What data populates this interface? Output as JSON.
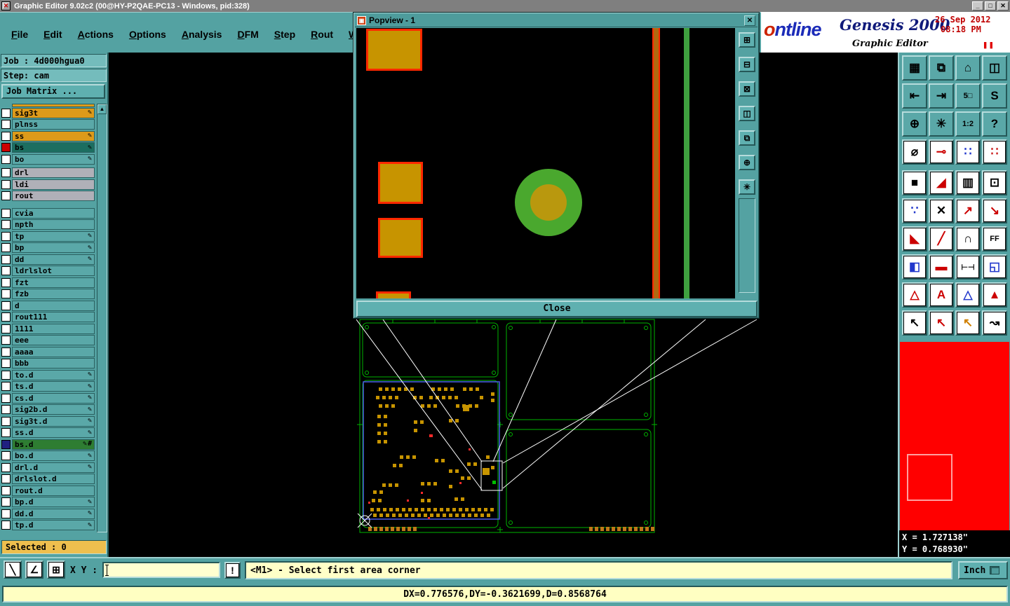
{
  "titlebar": {
    "title": "Graphic Editor 9.02c2 (00@HY-P2QAE-PC13 - Windows, pid:328)",
    "minimize": "_",
    "maximize": "□",
    "close": "✕"
  },
  "menu": {
    "items": [
      "File",
      "Edit",
      "Actions",
      "Options",
      "Analysis",
      "DFM",
      "Step",
      "Rout",
      "Windows"
    ]
  },
  "brand": {
    "logo": "ontline",
    "product": "Genesis 2000",
    "app": "Graphic Editor",
    "date": "26 Sep 2012",
    "time": "08:18 PM",
    "pause": "❚❚"
  },
  "job": {
    "job": "Job : 4d000hgua0",
    "step": "Step: cam",
    "matrix": "Job Matrix ..."
  },
  "layers": {
    "rows": [
      {
        "name": "sig3t",
        "style": "lorange",
        "pencil": true
      },
      {
        "name": "plnss",
        "style": "lteal",
        "pencil": false
      },
      {
        "name": "ss",
        "style": "lorange",
        "pencil": true
      },
      {
        "name": "bs",
        "style": "ldark",
        "pencil": true,
        "indicator": "#cc0000"
      },
      {
        "name": "bo",
        "style": "lteal",
        "pencil": true
      },
      {
        "name": "drl",
        "style": "lgray",
        "pencil": false,
        "gap": 3
      },
      {
        "name": "ldi",
        "style": "lgray",
        "pencil": false
      },
      {
        "name": "rout",
        "style": "lgray",
        "pencil": false
      },
      {
        "name": "cvia",
        "style": "lteal",
        "pencil": false,
        "gap": 8
      },
      {
        "name": "npth",
        "style": "lteal",
        "pencil": false
      },
      {
        "name": "tp",
        "style": "lteal",
        "pencil": true
      },
      {
        "name": "bp",
        "style": "lteal",
        "pencil": true
      },
      {
        "name": "dd",
        "style": "lteal",
        "pencil": true
      },
      {
        "name": "ldrlslot",
        "style": "lteal",
        "pencil": false
      },
      {
        "name": "fzt",
        "style": "lteal",
        "pencil": false
      },
      {
        "name": "fzb",
        "style": "lteal",
        "pencil": false
      },
      {
        "name": "d",
        "style": "lteal",
        "pencil": false
      },
      {
        "name": "rout111",
        "style": "lteal",
        "pencil": false
      },
      {
        "name": "1111",
        "style": "lteal",
        "pencil": false
      },
      {
        "name": "eee",
        "style": "lteal",
        "pencil": false
      },
      {
        "name": "aaaa",
        "style": "lteal",
        "pencil": false
      },
      {
        "name": "bbb",
        "style": "lteal",
        "pencil": false
      },
      {
        "name": "to.d",
        "style": "lteal",
        "pencil": true
      },
      {
        "name": "ts.d",
        "style": "lteal",
        "pencil": true
      },
      {
        "name": "cs.d",
        "style": "lteal",
        "pencil": true
      },
      {
        "name": "sig2b.d",
        "style": "lteal",
        "pencil": true
      },
      {
        "name": "sig3t.d",
        "style": "lteal",
        "pencil": true
      },
      {
        "name": "ss.d",
        "style": "lteal",
        "pencil": true
      },
      {
        "name": "bs.d",
        "style": "lgreen",
        "pencil": true,
        "indicator": "#202080",
        "hash": true
      },
      {
        "name": "bo.d",
        "style": "lteal",
        "pencil": true
      },
      {
        "name": "drl.d",
        "style": "lteal",
        "pencil": true
      },
      {
        "name": "drlslot.d",
        "style": "lteal",
        "pencil": false
      },
      {
        "name": "rout.d",
        "style": "lteal",
        "pencil": false
      },
      {
        "name": "bp.d",
        "style": "lteal",
        "pencil": true
      },
      {
        "name": "dd.d",
        "style": "lteal",
        "pencil": true
      },
      {
        "name": "tp.d",
        "style": "lteal",
        "pencil": true
      }
    ]
  },
  "selected": "Selected : 0",
  "popview": {
    "title": "Popview - 1",
    "close_x": "✕",
    "close": "Close",
    "tools": [
      {
        "name": "pv-new-window",
        "glyph": "⊞"
      },
      {
        "name": "pv-remove-window",
        "glyph": "⊟"
      },
      {
        "name": "pv-close-window",
        "glyph": "⊠"
      },
      {
        "name": "pv-split-window",
        "glyph": "◫"
      },
      {
        "name": "pv-duplicate-window",
        "glyph": "⧉"
      },
      {
        "name": "pv-zoom-window",
        "glyph": "⊕"
      },
      {
        "name": "pv-pan-window",
        "glyph": "✳"
      }
    ]
  },
  "right_toolbar": {
    "buttons": [
      {
        "name": "tool-panel-view",
        "glyph": "▦",
        "color": "#000000",
        "face": "teal"
      },
      {
        "name": "tool-screen-view",
        "glyph": "⧉",
        "color": "#000000",
        "face": "teal"
      },
      {
        "name": "tool-home-view",
        "glyph": "⌂",
        "color": "#000000",
        "face": "teal"
      },
      {
        "name": "tool-split-view",
        "glyph": "◫",
        "color": "#000000",
        "face": "teal"
      },
      {
        "name": "tool-zoom-in-window",
        "glyph": "⇤",
        "color": "#000000",
        "face": "teal"
      },
      {
        "name": "tool-zoom-out-window",
        "glyph": "⇥",
        "color": "#000000",
        "face": "teal"
      },
      {
        "name": "tool-zoom-5",
        "glyph": "5□",
        "color": "#000000",
        "face": "teal"
      },
      {
        "name": "tool-s-route",
        "glyph": "S",
        "color": "#000000",
        "face": "teal"
      },
      {
        "name": "tool-zoom-fit",
        "glyph": "⊕",
        "color": "#000000",
        "face": "teal"
      },
      {
        "name": "tool-pan",
        "glyph": "✳",
        "color": "#000000",
        "face": "teal"
      },
      {
        "name": "tool-scale-1-2",
        "glyph": "1:2",
        "color": "#000000",
        "face": "teal"
      },
      {
        "name": "tool-help",
        "glyph": "?",
        "color": "#000000",
        "face": "teal"
      },
      {
        "name": "tool-measure-curve",
        "glyph": "⌀",
        "color": "#000000",
        "face": "white"
      },
      {
        "name": "tool-measure-point",
        "glyph": "⊸",
        "color": "#cc0000",
        "face": "white"
      },
      {
        "name": "tool-net-points-blue",
        "glyph": "∷",
        "color": "#2238cc",
        "face": "white"
      },
      {
        "name": "tool-net-points-red",
        "glyph": "∷",
        "color": "#cc2222",
        "face": "white"
      },
      {
        "name": "tool-pad-select",
        "glyph": "■",
        "color": "#000000",
        "face": "white"
      },
      {
        "name": "tool-triangle-ruler",
        "glyph": "◢",
        "color": "#cc0000",
        "face": "white"
      },
      {
        "name": "tool-hatch",
        "glyph": "▥",
        "color": "#000000",
        "face": "white"
      },
      {
        "name": "tool-dotted-frame",
        "glyph": "⊡",
        "color": "#000000",
        "face": "white"
      },
      {
        "name": "tool-node-pair",
        "glyph": "∵",
        "color": "#2238cc",
        "face": "white"
      },
      {
        "name": "tool-delete-point",
        "glyph": "✕",
        "color": "#000000",
        "face": "white"
      },
      {
        "name": "tool-move-up-right",
        "glyph": "↗",
        "color": "#cc0000",
        "face": "white"
      },
      {
        "name": "tool-move-down-right",
        "glyph": "↘",
        "color": "#cc0000",
        "face": "white"
      },
      {
        "name": "tool-angle",
        "glyph": "◣",
        "color": "#cc0000",
        "face": "white"
      },
      {
        "name": "tool-slope",
        "glyph": "╱",
        "color": "#cc0000",
        "face": "white"
      },
      {
        "name": "tool-arc",
        "glyph": "∩",
        "color": "#000000",
        "face": "white"
      },
      {
        "name": "tool-mirror-f",
        "glyph": "FF",
        "color": "#000000",
        "face": "white"
      },
      {
        "name": "tool-swap-squares",
        "glyph": "◧",
        "color": "#2238cc",
        "face": "white"
      },
      {
        "name": "tool-red-bar",
        "glyph": "▬",
        "color": "#cc0000",
        "face": "white"
      },
      {
        "name": "tool-dimension",
        "glyph": "⊢⊣",
        "color": "#000000",
        "face": "white"
      },
      {
        "name": "tool-corner-square",
        "glyph": "◱",
        "color": "#2238cc",
        "face": "white"
      },
      {
        "name": "tool-triangle-outline",
        "glyph": "△",
        "color": "#cc0000",
        "face": "white"
      },
      {
        "name": "tool-text-a",
        "glyph": "A",
        "color": "#cc0000",
        "face": "white"
      },
      {
        "name": "tool-triangle-blue",
        "glyph": "△",
        "color": "#2238cc",
        "face": "white"
      },
      {
        "name": "tool-triangle-filled",
        "glyph": "▲",
        "color": "#cc0000",
        "face": "white"
      },
      {
        "name": "tool-select-cursor",
        "glyph": "↖",
        "color": "#000000",
        "face": "white"
      },
      {
        "name": "tool-select-point",
        "glyph": "↖",
        "color": "#cc0000",
        "face": "white"
      },
      {
        "name": "tool-select-query",
        "glyph": "↖",
        "color": "#d08000",
        "face": "white"
      },
      {
        "name": "tool-select-path",
        "glyph": "↝",
        "color": "#000000",
        "face": "white"
      }
    ]
  },
  "coords": {
    "x": "X = 1.727138\"",
    "y": "Y = 0.768930\""
  },
  "bottombar": {
    "tools": [
      {
        "name": "tool-diagonal-line",
        "glyph": "╲"
      },
      {
        "name": "tool-angle-snap",
        "glyph": "∠"
      },
      {
        "name": "tool-grid-toggle",
        "glyph": "⊞"
      }
    ],
    "xy": "X Y :",
    "input": "",
    "bang": "!",
    "message": "<M1> - Select first area corner",
    "units": "Inch"
  },
  "statusbar": "DX=0.776576,DY=-0.3621699,D=0.8568764",
  "colors": {
    "teal": "#54a2a2",
    "cream": "#ffffc8",
    "layer_highlight": "#dd9a1a",
    "layer_dark": "#1c6e60",
    "layer_green": "#2e7d32",
    "red_panel": "#ff0000",
    "pad_gold": "#c79400",
    "board_green": "#00b400",
    "step_blue": "#4a5ae8"
  }
}
